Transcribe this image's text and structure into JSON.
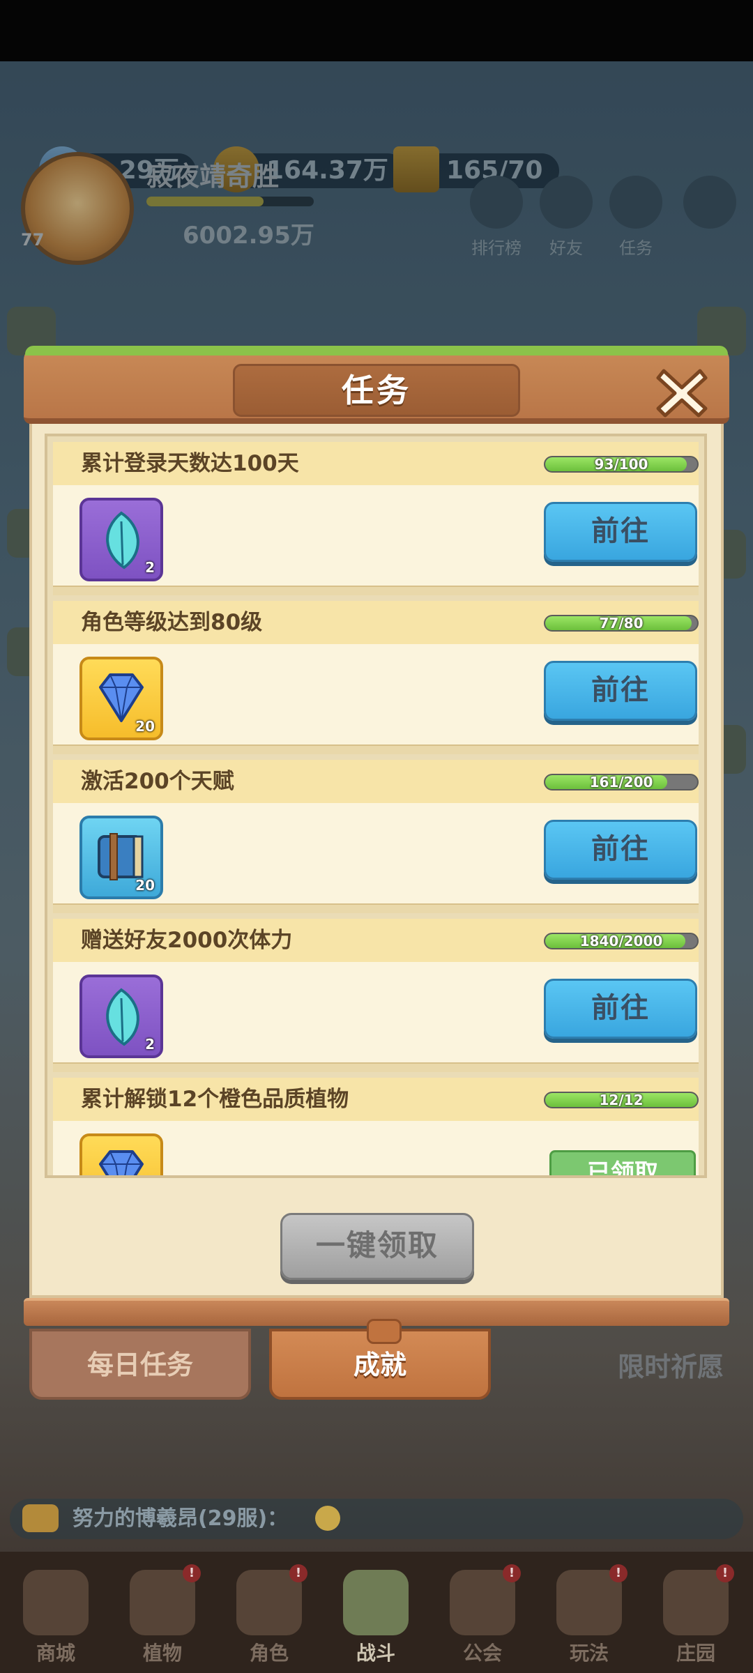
{
  "top": {
    "gems": "2.29万",
    "gold": "164.37万",
    "stamina": "165/70",
    "player_name": "寂夜靖奇胜",
    "player_level": "77",
    "power": "6002.95万",
    "buttons": [
      "排行榜",
      "好友",
      "任务"
    ]
  },
  "modal": {
    "title": "任务",
    "tasks": [
      {
        "title": "累计登录天数达100天",
        "progress_text": "93/100",
        "progress": 0.93,
        "reward_icon": "leaf-icon",
        "reward_count": "2",
        "action": "前往"
      },
      {
        "title": "角色等级达到80级",
        "progress_text": "77/80",
        "progress": 0.9625,
        "reward_icon": "diamond-icon",
        "reward_count": "20",
        "action": "前往"
      },
      {
        "title": "激活200个天赋",
        "progress_text": "161/200",
        "progress": 0.805,
        "reward_icon": "book-icon",
        "reward_count": "20",
        "action": "前往"
      },
      {
        "title": "赠送好友2000次体力",
        "progress_text": "1840/2000",
        "progress": 0.92,
        "reward_icon": "leaf-icon",
        "reward_count": "2",
        "action": "前往"
      },
      {
        "title": "累计解锁12个橙色品质植物",
        "progress_text": "12/12",
        "progress": 1.0,
        "reward_icon": "diamond-icon",
        "reward_count": "",
        "action": "已领取"
      }
    ],
    "claim_all": "一键领取",
    "tabs": {
      "daily": "每日任务",
      "achievement": "成就"
    }
  },
  "chat": {
    "message": "努力的博羲昂(29服)："
  },
  "nav": {
    "items": [
      "商城",
      "植物",
      "角色",
      "战斗",
      "公会",
      "玩法",
      "庄园"
    ],
    "active": "战斗"
  },
  "side_labels": {
    "wish": "限时祈愿"
  },
  "colors": {
    "go_button": "#39a6df",
    "progress_fill": "#6cc03c",
    "header": "#b97648",
    "panel": "#f3e7c8"
  }
}
